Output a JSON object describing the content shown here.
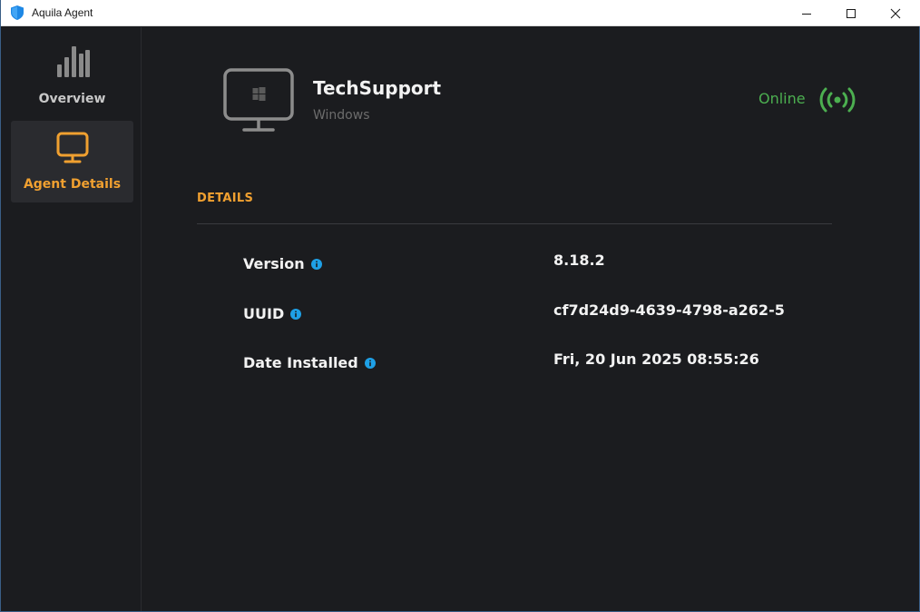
{
  "window": {
    "title": "Aquila Agent"
  },
  "sidebar": {
    "items": [
      {
        "label": "Overview",
        "icon": "bar-chart-icon",
        "active": false
      },
      {
        "label": "Agent Details",
        "icon": "monitor-icon",
        "active": true
      }
    ]
  },
  "agent": {
    "name": "TechSupport",
    "os": "Windows",
    "status": "Online",
    "status_icon": "broadcast-signal-icon"
  },
  "details": {
    "section_title": "DETAILS",
    "rows": [
      {
        "label": "Version",
        "value": "8.18.2"
      },
      {
        "label": "UUID",
        "value": "cf7d24d9-4639-4798-a262-5"
      },
      {
        "label": "Date Installed",
        "value": "Fri, 20 Jun 2025 08:55:26"
      }
    ]
  },
  "colors": {
    "accent": "#f0a030",
    "online": "#4caf50",
    "info": "#1ea0e6",
    "background": "#1b1c1f"
  }
}
